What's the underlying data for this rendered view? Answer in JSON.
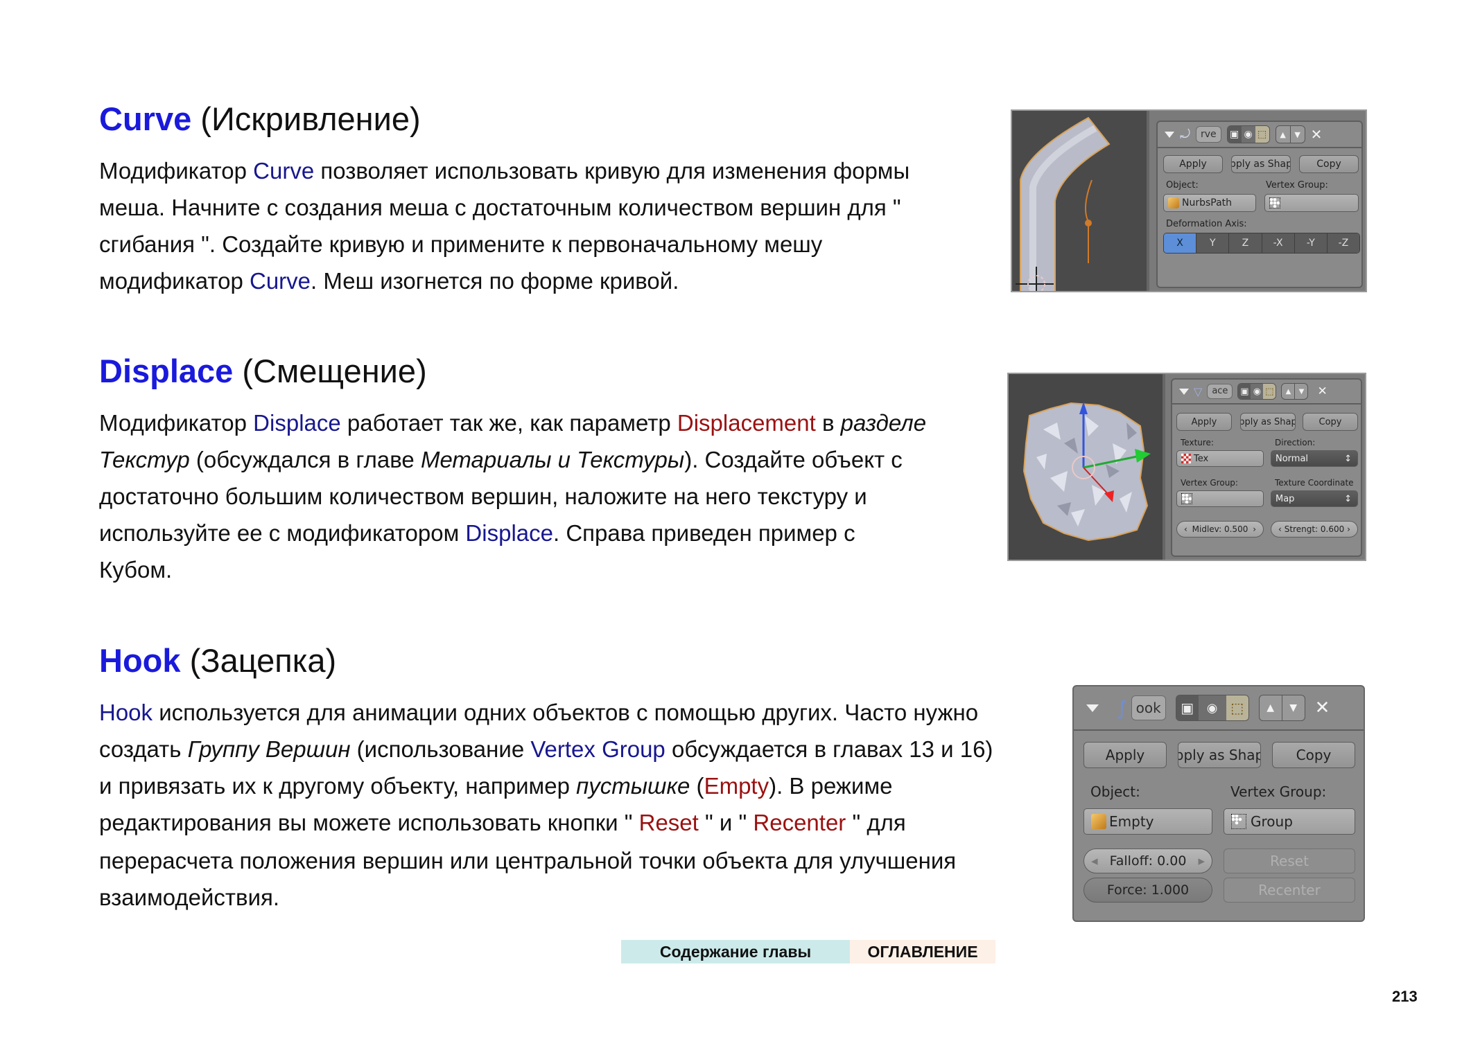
{
  "sections": {
    "curve": {
      "keyword": "Curve",
      "subtitle": "(Искривление)",
      "lines": [
        [
          "Модификатор ",
          "Curve",
          " позволяет использовать кривую для изменения формы"
        ],
        [
          "меша. Начните с создания меша с достаточным количеством вершин для \""
        ],
        [
          "сгибания \". Создайте кривую и примените к первоначальному мешу"
        ],
        [
          "модификатор ",
          "Curve",
          ". Меш изогнется по форме кривой."
        ]
      ],
      "panel": {
        "name_fragment": "rve",
        "buttons": [
          "Apply",
          "pply as Shap",
          "Copy"
        ],
        "object_label": "Object:",
        "object_value": "NurbsPath",
        "vgroup_label": "Vertex Group:",
        "vgroup_value": "",
        "axis_label": "Deformation Axis:",
        "axes": [
          "X",
          "Y",
          "Z",
          "-X",
          "-Y",
          "-Z"
        ],
        "selected_axis": "X"
      }
    },
    "displace": {
      "keyword": "Displace",
      "subtitle": "(Смещение)",
      "lines": [
        [
          "Модификатор ",
          "Displace",
          " работает так же, как параметр ",
          "Displacement",
          " в ",
          "разделе"
        ],
        [
          "Текстур",
          " (обсуждался в главе ",
          "Метариалы и Текстуры",
          "). Создайте объект с"
        ],
        [
          "достаточно большим количеством вершин, наложите на него текстуру и"
        ],
        [
          "используйте ее с модификатором ",
          "Displace",
          ". Справа приведен пример с"
        ],
        [
          "Кубом."
        ]
      ],
      "panel": {
        "name_fragment": "ace",
        "buttons": [
          "Apply",
          "pply as Shap",
          "Copy"
        ],
        "texture_label": "Texture:",
        "texture_value": "Tex",
        "direction_label": "Direction:",
        "direction_value": "Normal",
        "vgroup_label": "Vertex Group:",
        "vgroup_value": "",
        "texcoord_label": "Texture Coordinate",
        "texcoord_value": "Map",
        "midlevel": "Midlev: 0.500",
        "strength": "Strengt: 0.600"
      }
    },
    "hook": {
      "keyword": "Hook",
      "subtitle": "(Зацепка)",
      "lines": [
        [
          "Hook",
          " используется для анимации одних объектов с помощью других. Часто нужно"
        ],
        [
          "создать ",
          "Группу Вершин",
          " (использование ",
          "Vertex Group",
          " обсуждается в главах 13 и 16)"
        ],
        [
          "и привязать их к другому объекту, например ",
          "пустышке",
          " (",
          "Empty",
          "). В режиме"
        ],
        [
          "редактирования вы можете использовать кнопки \" ",
          "Reset",
          " \" и \" ",
          "Recenter",
          " \" для"
        ],
        [
          "перерасчета положения вершин или центральной точки объекта для улучшения"
        ],
        [
          "взаимодействия."
        ]
      ],
      "panel": {
        "name_fragment": "ook",
        "buttons": [
          "Apply",
          "pply as Shap",
          "Copy"
        ],
        "object_label": "Object:",
        "object_value": "Empty",
        "vgroup_label": "Vertex Group:",
        "vgroup_value": "Group",
        "falloff": "Falloff: 0.00",
        "force": "Force: 1.000",
        "reset": "Reset",
        "recenter": "Recenter"
      }
    }
  },
  "nav": {
    "chapter_contents": "Содержание главы",
    "table_of_contents": "ОГЛАВЛЕНИЕ"
  },
  "page_number": "213",
  "colors": {
    "heading_keyword": "#1a1adc",
    "link_blue": "#17178f",
    "term_red": "#9a1111",
    "nav_chapter_bg": "#cdeaea",
    "nav_toc_bg": "#fdf0e6"
  }
}
